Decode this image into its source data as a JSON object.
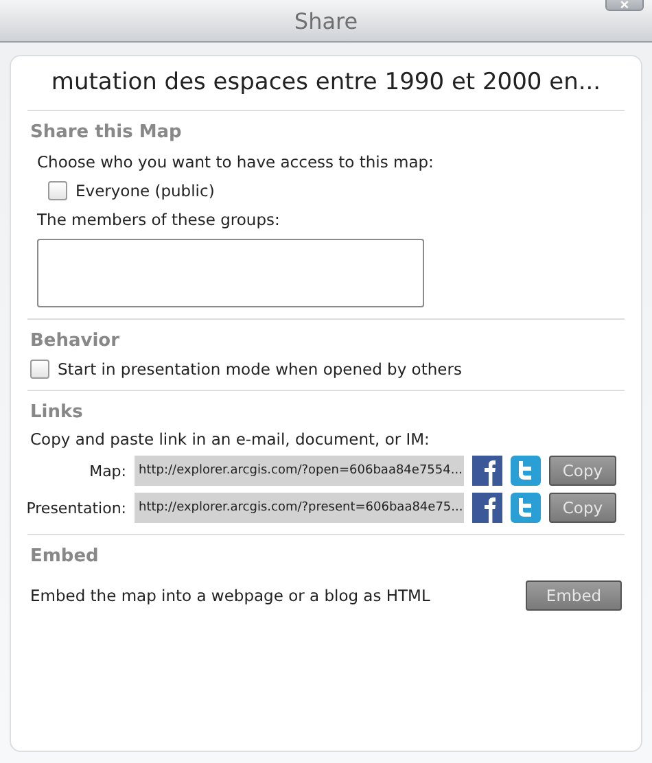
{
  "window": {
    "title": "Share",
    "close_label": "×"
  },
  "map_title": "mutation des espaces entre 1990 et 2000 en...",
  "share": {
    "heading": "Share this Map",
    "prompt": "Choose who you want to have access to this map:",
    "everyone": {
      "label": "Everyone (public)",
      "checked": false
    },
    "groups_label": "The members of these groups:"
  },
  "behavior": {
    "heading": "Behavior",
    "presentation_mode": {
      "label": "Start in presentation mode when opened by others",
      "checked": false
    }
  },
  "links": {
    "heading": "Links",
    "prompt": "Copy and paste link in an e-mail, document, or IM:",
    "rows": [
      {
        "label": "Map:",
        "url": "http://explorer.arcgis.com/?open=606baa84e7554...",
        "copy": "Copy"
      },
      {
        "label": "Presentation:",
        "url": "http://explorer.arcgis.com/?present=606baa84e75...",
        "copy": "Copy"
      }
    ]
  },
  "embed": {
    "heading": "Embed",
    "text": "Embed the map into a webpage or a blog as HTML",
    "button": "Embed"
  }
}
